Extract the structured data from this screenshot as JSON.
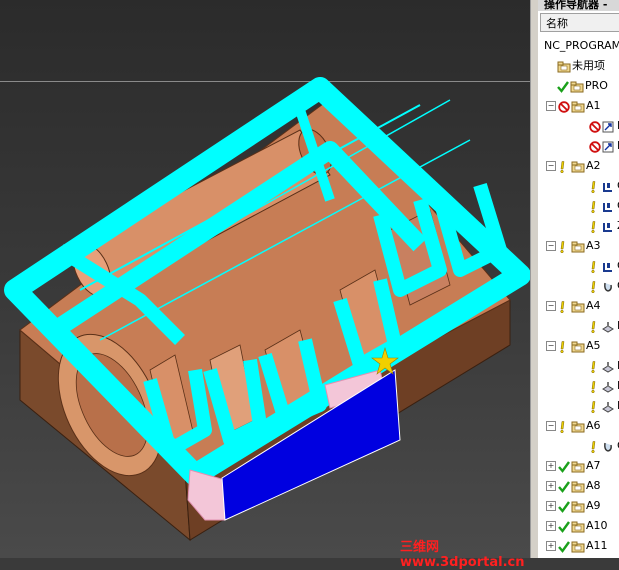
{
  "navigator": {
    "title": "操作导航器 -",
    "column_header": "名称",
    "items": [
      {
        "label": "NC_PROGRAM",
        "level": 0,
        "status": "",
        "icon": "program-root-icon"
      },
      {
        "label": "未用项",
        "level": 1,
        "status": "",
        "icon": "folder-icon"
      },
      {
        "label": "PRO",
        "level": 1,
        "status": "check",
        "icon": "folder-icon"
      },
      {
        "label": "A1",
        "level": 1,
        "status": "prohibit",
        "icon": "folder-icon",
        "expand": "−"
      },
      {
        "label": "D",
        "level": 2,
        "status": "prohibit",
        "icon": "drill-operation-icon"
      },
      {
        "label": "F",
        "level": 2,
        "status": "prohibit",
        "icon": "drill-operation-icon"
      },
      {
        "label": "A2",
        "level": 1,
        "status": "warning",
        "icon": "folder-icon",
        "expand": "−"
      },
      {
        "label": "C",
        "level": 2,
        "status": "warning",
        "icon": "cavity-mill-icon"
      },
      {
        "label": "C",
        "level": 2,
        "status": "warning",
        "icon": "cavity-mill-icon"
      },
      {
        "label": "Z",
        "level": 2,
        "status": "warning",
        "icon": "cavity-mill-icon"
      },
      {
        "label": "A3",
        "level": 1,
        "status": "warning",
        "icon": "folder-icon",
        "expand": "−"
      },
      {
        "label": "C",
        "level": 2,
        "status": "warning",
        "icon": "cavity-mill-icon"
      },
      {
        "label": "C",
        "level": 2,
        "status": "warning",
        "icon": "contour-mill-icon"
      },
      {
        "label": "A4",
        "level": 1,
        "status": "warning",
        "icon": "folder-icon",
        "expand": "−"
      },
      {
        "label": "F",
        "level": 2,
        "status": "warning",
        "icon": "face-mill-icon"
      },
      {
        "label": "A5",
        "level": 1,
        "status": "warning",
        "icon": "folder-icon",
        "expand": "−"
      },
      {
        "label": "F",
        "level": 2,
        "status": "warning",
        "icon": "face-mill-icon"
      },
      {
        "label": "F",
        "level": 2,
        "status": "warning",
        "icon": "face-mill-icon"
      },
      {
        "label": "F",
        "level": 2,
        "status": "warning",
        "icon": "face-mill-icon"
      },
      {
        "label": "A6",
        "level": 1,
        "status": "warning",
        "icon": "folder-icon",
        "expand": "−"
      },
      {
        "label": "C",
        "level": 2,
        "status": "warning",
        "icon": "contour-mill-icon"
      },
      {
        "label": "A7",
        "level": 1,
        "status": "check",
        "icon": "folder-icon",
        "expand": "+"
      },
      {
        "label": "A8",
        "level": 1,
        "status": "check",
        "icon": "folder-icon",
        "expand": "+"
      },
      {
        "label": "A9",
        "level": 1,
        "status": "check",
        "icon": "folder-icon",
        "expand": "+"
      },
      {
        "label": "A10",
        "level": 1,
        "status": "check",
        "icon": "folder-icon",
        "expand": "+"
      },
      {
        "label": "A11",
        "level": 1,
        "status": "check",
        "icon": "folder-icon",
        "expand": "+"
      }
    ]
  },
  "watermark": "三维网www.3dportal.cn",
  "colors": {
    "toolpath": "#00ffff",
    "part_copper": "#c77d55",
    "blank_blue": "#0000e0",
    "check_green": "#1aa01a",
    "warning_yellow": "#e8d000",
    "prohibit_red": "#d01010"
  }
}
